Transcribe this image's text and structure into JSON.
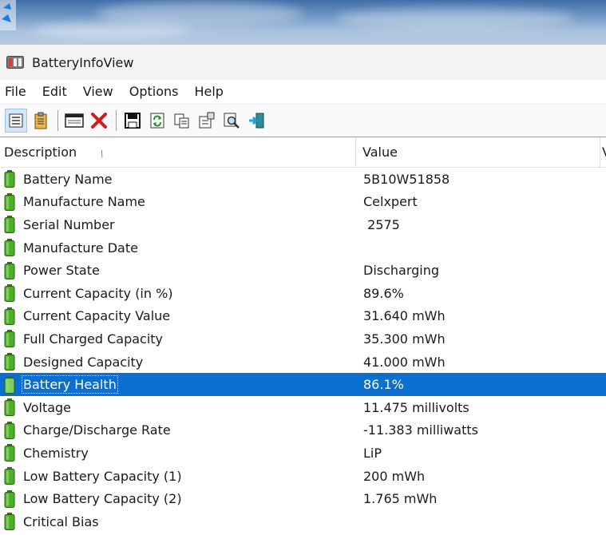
{
  "window": {
    "title": "BatteryInfoView"
  },
  "menu": [
    "File",
    "Edit",
    "View",
    "Options",
    "Help"
  ],
  "toolbar": {
    "buttons": [
      {
        "icon": "html-report-icon"
      },
      {
        "icon": "clipboard-list-icon"
      },
      {
        "icon": "window-icon"
      },
      {
        "icon": "delete-icon"
      },
      {
        "icon": "save-icon"
      },
      {
        "icon": "refresh-icon"
      },
      {
        "icon": "copy-icon"
      },
      {
        "icon": "properties-icon"
      },
      {
        "icon": "find-icon"
      },
      {
        "icon": "exit-icon"
      }
    ]
  },
  "columns": {
    "description": "Description",
    "value": "Value",
    "extra": "V"
  },
  "rows": [
    {
      "desc": "Battery Name",
      "value": "5B10W51858"
    },
    {
      "desc": "Manufacture Name",
      "value": "Celxpert"
    },
    {
      "desc": "Serial Number",
      "value": " 2575"
    },
    {
      "desc": "Manufacture Date",
      "value": ""
    },
    {
      "desc": "Power State",
      "value": "Discharging"
    },
    {
      "desc": "Current Capacity (in %)",
      "value": "89.6%"
    },
    {
      "desc": "Current Capacity Value",
      "value": "31.640 mWh"
    },
    {
      "desc": "Full Charged Capacity",
      "value": "35.300 mWh"
    },
    {
      "desc": "Designed Capacity",
      "value": "41.000 mWh"
    },
    {
      "desc": "Battery Health",
      "value": "86.1%"
    },
    {
      "desc": "Voltage",
      "value": "11.475 millivolts"
    },
    {
      "desc": "Charge/Discharge Rate",
      "value": "-11.383 milliwatts"
    },
    {
      "desc": "Chemistry",
      "value": "LiP"
    },
    {
      "desc": "Low Battery Capacity (1)",
      "value": "200 mWh"
    },
    {
      "desc": "Low Battery Capacity (2)",
      "value": "1.765 mWh"
    },
    {
      "desc": "Critical Bias",
      "value": ""
    }
  ],
  "colors": {
    "selection": "#0a6fd1",
    "battery_green": "#4caf2a"
  }
}
